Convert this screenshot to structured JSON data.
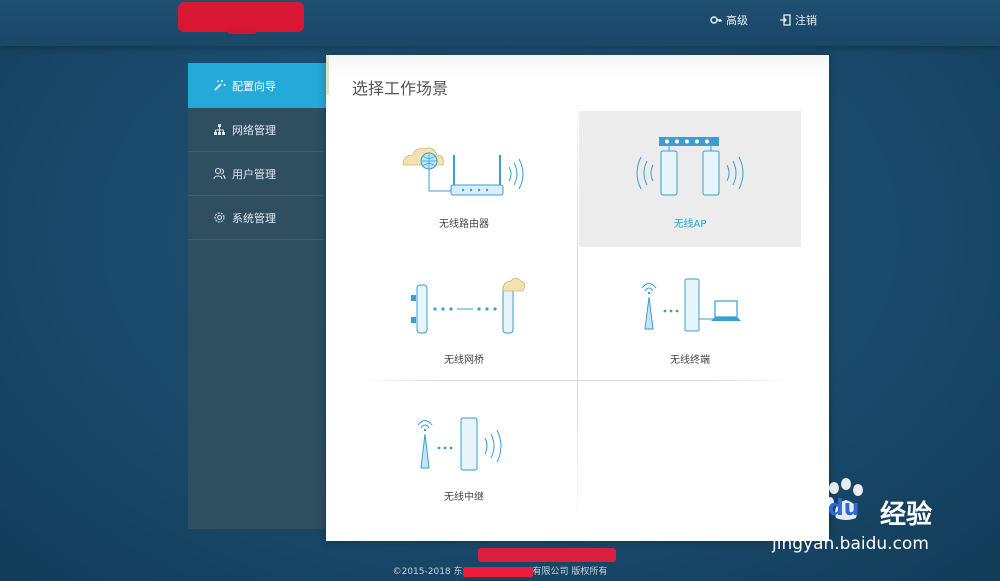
{
  "header": {
    "advanced_label": "高级",
    "logout_label": "注销"
  },
  "sidebar": {
    "items": [
      {
        "label": "配置向导",
        "icon": "magic-wand-icon",
        "active": true
      },
      {
        "label": "网络管理",
        "icon": "network-tree-icon",
        "active": false
      },
      {
        "label": "用户管理",
        "icon": "users-icon",
        "active": false
      },
      {
        "label": "系统管理",
        "icon": "gear-icon",
        "active": false
      }
    ]
  },
  "panel": {
    "title": "选择工作场景",
    "scenes": [
      {
        "label": "无线路由器",
        "icon": "wireless-router-icon",
        "selected": false
      },
      {
        "label": "无线AP",
        "icon": "wireless-ap-icon",
        "selected": true
      },
      {
        "label": "无线网桥",
        "icon": "wireless-bridge-icon",
        "selected": false
      },
      {
        "label": "无线终端",
        "icon": "wireless-client-icon",
        "selected": false
      },
      {
        "label": "无线中继",
        "icon": "wireless-repeater-icon",
        "selected": false
      }
    ]
  },
  "footer": {
    "copyright_start": "©2015-2018 东",
    "copyright_end": "有限公司 版权所有"
  },
  "watermark": {
    "brand": "Bai",
    "brand_end": "du",
    "cn": "经验",
    "url": "jingyan.baidu.com"
  },
  "colors": {
    "accent": "#24a9d9",
    "sidebar": "#2f4f61",
    "redaction": "#ee1b3a"
  }
}
